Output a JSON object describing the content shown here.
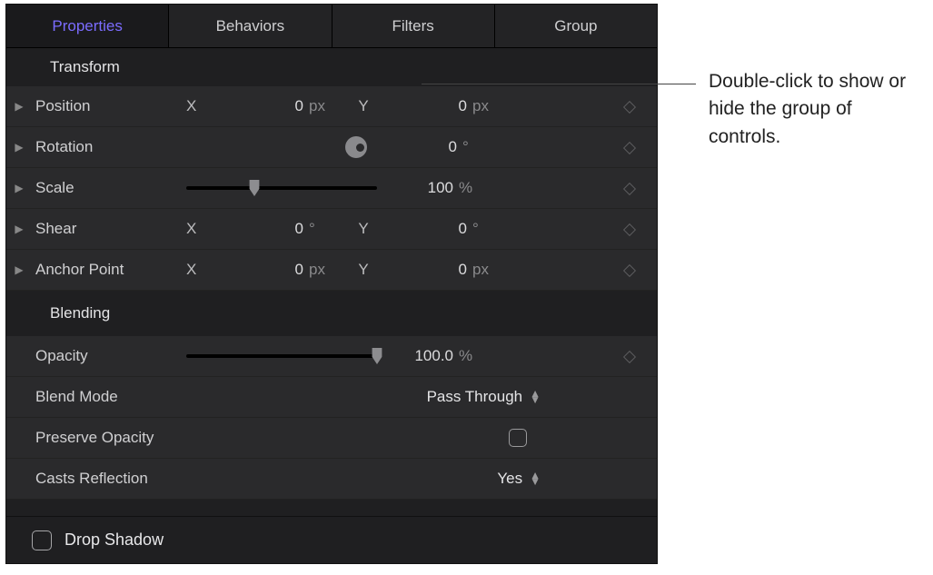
{
  "tabs": [
    "Properties",
    "Behaviors",
    "Filters",
    "Group"
  ],
  "activeTab": 0,
  "sections": {
    "transform": {
      "title": "Transform",
      "position": {
        "label": "Position",
        "xLabel": "X",
        "x": "0",
        "xUnit": "px",
        "yLabel": "Y",
        "y": "0",
        "yUnit": "px"
      },
      "rotation": {
        "label": "Rotation",
        "value": "0",
        "unit": "°"
      },
      "scale": {
        "label": "Scale",
        "value": "100",
        "unit": "%"
      },
      "shear": {
        "label": "Shear",
        "xLabel": "X",
        "x": "0",
        "xUnit": "°",
        "yLabel": "Y",
        "y": "0",
        "yUnit": "°"
      },
      "anchor": {
        "label": "Anchor Point",
        "xLabel": "X",
        "x": "0",
        "xUnit": "px",
        "yLabel": "Y",
        "y": "0",
        "yUnit": "px"
      }
    },
    "blending": {
      "title": "Blending",
      "opacity": {
        "label": "Opacity",
        "value": "100.0",
        "unit": "%"
      },
      "blendMode": {
        "label": "Blend Mode",
        "value": "Pass Through"
      },
      "preserve": {
        "label": "Preserve Opacity",
        "checked": false
      },
      "casts": {
        "label": "Casts Reflection",
        "value": "Yes"
      }
    },
    "dropShadow": {
      "label": "Drop Shadow",
      "checked": false
    }
  },
  "callout": "Double-click to show or hide the group of controls."
}
